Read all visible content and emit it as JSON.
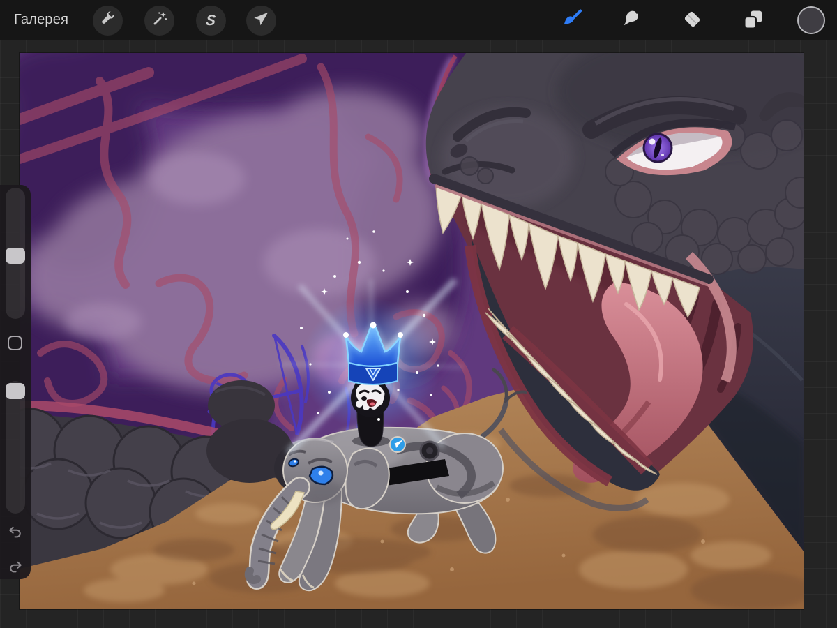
{
  "theme": {
    "app-bg": "#242424",
    "topbar-bg": "#161616",
    "button-bg": "#2b2b2b",
    "accent": "#2e7cf6",
    "sidebar-bg": "rgba(28,25,30,0.95)",
    "slider-track": "rgba(255,255,255,0.09)",
    "slider-handle": "#c8c6c9",
    "current-color": "#3f3d43",
    "canvas-base": "#60397e"
  },
  "topbar": {
    "gallery_label": "Галерея",
    "left_tools": [
      {
        "id": "actions",
        "icon": "wrench-icon"
      },
      {
        "id": "adjustments",
        "icon": "magic-wand-icon"
      },
      {
        "id": "selection",
        "icon": "s-ribbon-icon",
        "glyph": "S"
      },
      {
        "id": "transform",
        "icon": "transform-arrow-icon"
      }
    ],
    "right_tools": [
      {
        "id": "paint",
        "icon": "brush-icon",
        "active": true,
        "color": "#2e7cf6"
      },
      {
        "id": "smudge",
        "icon": "smudge-finger-icon"
      },
      {
        "id": "erase",
        "icon": "eraser-icon"
      },
      {
        "id": "layers",
        "icon": "layers-icon"
      },
      {
        "id": "color",
        "icon": "color-circle",
        "value": "#3f3d43"
      }
    ]
  },
  "sidebar": {
    "brush_size_slider": {
      "icon": "size-slider"
    },
    "modify_button": {
      "icon": "square-outline-icon"
    },
    "opacity_slider": {
      "icon": "opacity-slider"
    },
    "undo": {
      "icon": "undo-arrow-icon"
    },
    "redo": {
      "icon": "redo-arrow-icon"
    }
  },
  "canvas": {
    "artwork_elements": [
      "purple-sky",
      "crimson-doodles",
      "blue-archer-sketch",
      "mauve-clouds",
      "dark-dragon-open-mouth",
      "purple-slit-eye",
      "scaled-tail",
      "rocky-brown-ground",
      "robot-elephant",
      "telegram-plane-badge",
      "coin-slot",
      "black-character-husky-face",
      "glowing-ton-crown",
      "sparkles"
    ],
    "palette": {
      "sky_purple": "#60397e",
      "cloud_mauve": "#94789f",
      "doodle_crimson": "#a84b68",
      "sketch_blue": "#4a38c2",
      "dragon_gray": "#46424d",
      "mouth_maroon": "#6a3240",
      "tongue_pink": "#c6707c",
      "teeth_cream": "#ece2cd",
      "ground_brown": "#a87a4f",
      "elephant_gray": "#8a878d",
      "crown_blue": "#2f7ff5",
      "glow_blue": "#7fc4ff"
    }
  }
}
